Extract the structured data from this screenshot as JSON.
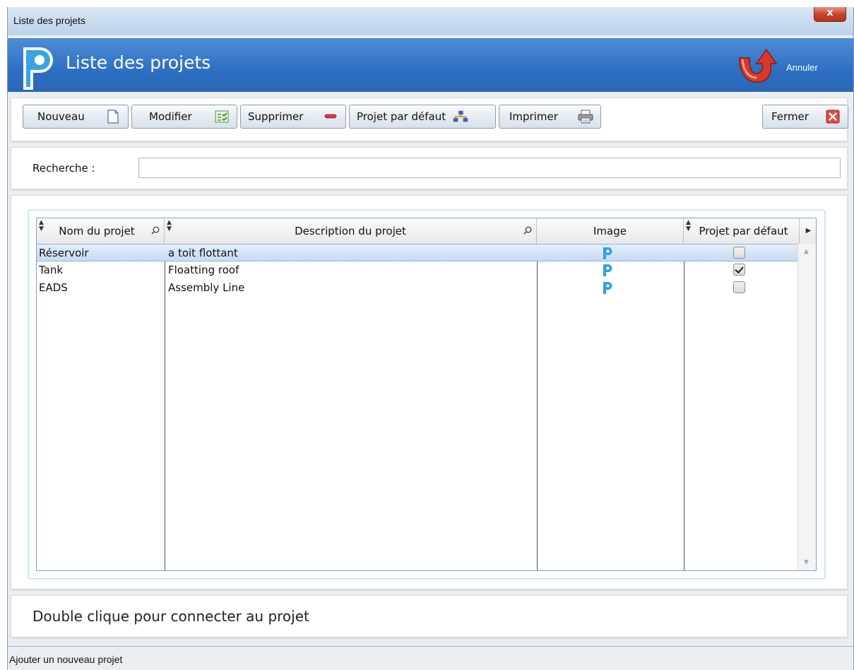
{
  "window": {
    "title": "Liste des projets",
    "close_label": "x"
  },
  "banner": {
    "title": "Liste des projets",
    "action_label": "Annuler",
    "brand_color": "#2d6fc3"
  },
  "toolbar": {
    "new_label": "Nouveau",
    "edit_label": "Modifier",
    "delete_label": "Supprimer",
    "default_label": "Projet par défaut",
    "print_label": "Imprimer",
    "close_label": "Fermer"
  },
  "search": {
    "label": "Recherche :",
    "value": ""
  },
  "grid": {
    "columns": [
      "Nom du projet",
      "Description du projet",
      "Image",
      "Projet par défaut"
    ],
    "rows": [
      {
        "name": "Réservoir",
        "description": "a toit flottant",
        "image_icon": "project-logo-icon",
        "default": false,
        "selected": true
      },
      {
        "name": "Tank",
        "description": "Floatting roof",
        "image_icon": "project-logo-icon",
        "default": true,
        "selected": false
      },
      {
        "name": "EADS",
        "description": "Assembly Line",
        "image_icon": "project-logo-icon",
        "default": false,
        "selected": false
      }
    ]
  },
  "hint": "Double clique pour connecter au projet",
  "status": "Ajouter un nouveau projet"
}
